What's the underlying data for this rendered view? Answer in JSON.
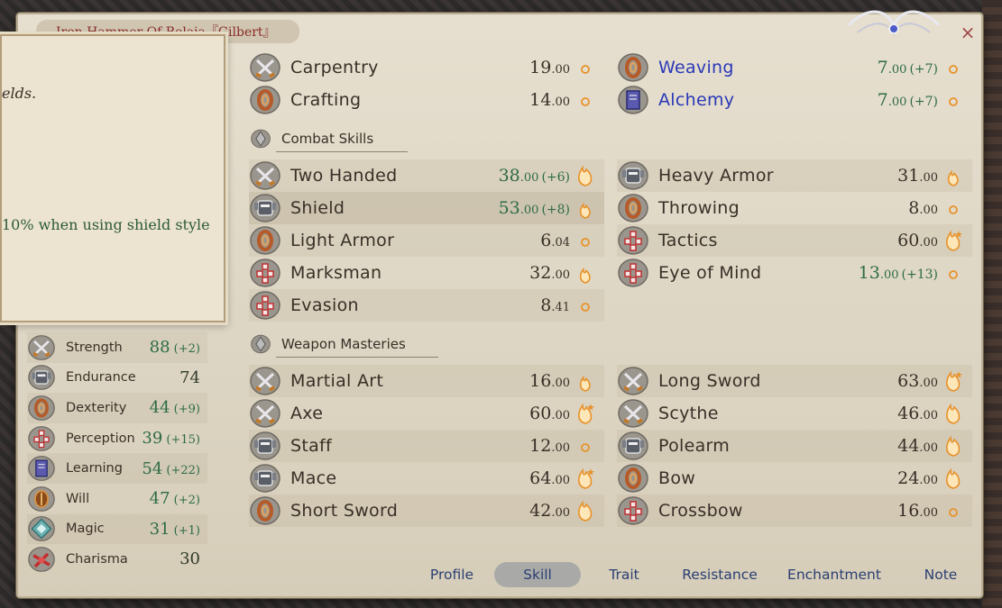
{
  "window": {
    "title": "Iron Hammer Of Belaja『Gilbert』",
    "close_label": "×"
  },
  "tooltip": {
    "line1": "elds.",
    "line2": "10% when using shield style"
  },
  "attributes": [
    {
      "name": "Strength",
      "value": "88",
      "bonus": "(+2)",
      "green": true,
      "icon": "crossed-swords-icon"
    },
    {
      "name": "Endurance",
      "value": "74",
      "bonus": "",
      "green": false,
      "icon": "armor-icon"
    },
    {
      "name": "Dexterity",
      "value": "44",
      "bonus": "(+9)",
      "green": true,
      "icon": "ring-icon"
    },
    {
      "name": "Perception",
      "value": "39",
      "bonus": "(+15)",
      "green": true,
      "icon": "grid-icon"
    },
    {
      "name": "Learning",
      "value": "54",
      "bonus": "(+22)",
      "green": true,
      "icon": "book-icon"
    },
    {
      "name": "Will",
      "value": "47",
      "bonus": "(+2)",
      "green": true,
      "icon": "will-icon"
    },
    {
      "name": "Magic",
      "value": "31",
      "bonus": "(+1)",
      "green": true,
      "icon": "magic-icon"
    },
    {
      "name": "Charisma",
      "value": "30",
      "bonus": "",
      "green": false,
      "icon": "bow-icon"
    }
  ],
  "top_skills": [
    {
      "name": "Carpentry",
      "value": "19",
      "dec": ".00",
      "bonus": "",
      "icon": "crossed-swords-icon",
      "potential": "small",
      "col": 0,
      "row": 0
    },
    {
      "name": "Crafting",
      "value": "14",
      "dec": ".00",
      "bonus": "",
      "icon": "ring-icon",
      "potential": "small",
      "col": 0,
      "row": 1
    },
    {
      "name": "Weaving",
      "value": "7",
      "dec": ".00",
      "bonus": "(+7)",
      "icon": "ring-icon",
      "potential": "small",
      "col": 1,
      "row": 0,
      "blue": true
    },
    {
      "name": "Alchemy",
      "value": "7",
      "dec": ".00",
      "bonus": "(+7)",
      "icon": "book-icon",
      "potential": "small",
      "col": 1,
      "row": 1,
      "blue": true
    }
  ],
  "sections": {
    "combat": "Combat Skills",
    "weapon": "Weapon Masteries"
  },
  "combat_skills": [
    {
      "name": "Two Handed",
      "value": "38",
      "dec": ".00",
      "bonus": "(+6)",
      "icon": "crossed-swords-icon",
      "potential": "big"
    },
    {
      "name": "Heavy Armor",
      "value": "31",
      "dec": ".00",
      "bonus": "",
      "icon": "armor-icon",
      "potential": "medium"
    },
    {
      "name": "Shield",
      "value": "53",
      "dec": ".00",
      "bonus": "(+8)",
      "icon": "armor-icon",
      "potential": "medium"
    },
    {
      "name": "Throwing",
      "value": "8",
      "dec": ".00",
      "bonus": "",
      "icon": "ring-icon",
      "potential": "small"
    },
    {
      "name": "Light Armor",
      "value": "6",
      "dec": ".04",
      "bonus": "",
      "icon": "ring-icon",
      "potential": "small"
    },
    {
      "name": "Tactics",
      "value": "60",
      "dec": ".00",
      "bonus": "",
      "icon": "grid-icon",
      "potential": "max"
    },
    {
      "name": "Marksman",
      "value": "32",
      "dec": ".00",
      "bonus": "",
      "icon": "grid-icon",
      "potential": "medium"
    },
    {
      "name": "Eye of Mind",
      "value": "13",
      "dec": ".00",
      "bonus": "(+13)",
      "icon": "grid-icon",
      "potential": "small"
    },
    {
      "name": "Evasion",
      "value": "8",
      "dec": ".41",
      "bonus": "",
      "icon": "grid-icon",
      "potential": "small"
    }
  ],
  "weapon_skills": [
    {
      "name": "Martial Art",
      "value": "16",
      "dec": ".00",
      "bonus": "",
      "icon": "crossed-swords-icon",
      "potential": "medium"
    },
    {
      "name": "Long Sword",
      "value": "63",
      "dec": ".00",
      "bonus": "",
      "icon": "crossed-swords-icon",
      "potential": "max"
    },
    {
      "name": "Axe",
      "value": "60",
      "dec": ".00",
      "bonus": "",
      "icon": "crossed-swords-icon",
      "potential": "max"
    },
    {
      "name": "Scythe",
      "value": "46",
      "dec": ".00",
      "bonus": "",
      "icon": "crossed-swords-icon",
      "potential": "big"
    },
    {
      "name": "Staff",
      "value": "12",
      "dec": ".00",
      "bonus": "",
      "icon": "armor-icon",
      "potential": "small"
    },
    {
      "name": "Polearm",
      "value": "44",
      "dec": ".00",
      "bonus": "",
      "icon": "armor-icon",
      "potential": "big"
    },
    {
      "name": "Mace",
      "value": "64",
      "dec": ".00",
      "bonus": "",
      "icon": "armor-icon",
      "potential": "max"
    },
    {
      "name": "Bow",
      "value": "24",
      "dec": ".00",
      "bonus": "",
      "icon": "ring-icon",
      "potential": "big"
    },
    {
      "name": "Short Sword",
      "value": "42",
      "dec": ".00",
      "bonus": "",
      "icon": "ring-icon",
      "potential": "big"
    },
    {
      "name": "Crossbow",
      "value": "16",
      "dec": ".00",
      "bonus": "",
      "icon": "grid-icon",
      "potential": "small"
    }
  ],
  "tabs": [
    {
      "label": "Profile",
      "active": false
    },
    {
      "label": "Skill",
      "active": true
    },
    {
      "label": "Trait",
      "active": false
    },
    {
      "label": "Resistance",
      "active": false
    },
    {
      "label": "Enchantment",
      "active": false
    },
    {
      "label": "Note",
      "active": false
    }
  ],
  "colors": {
    "panel": "#e6dfcf",
    "green_value": "#2e6b46",
    "blue_skill": "#2a38b8",
    "tab_text": "#2a3f72",
    "title_red": "#8a2a2a"
  }
}
